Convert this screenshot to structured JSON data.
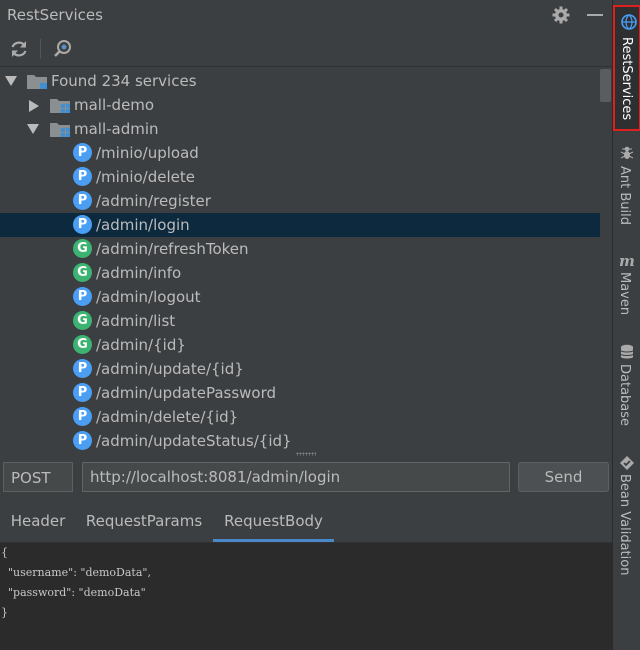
{
  "window": {
    "title": "RestServices"
  },
  "toolbar": {
    "refresh_icon": "refresh-icon",
    "search_icon": "search-service-icon"
  },
  "tree": {
    "root_label": "Found 234 services",
    "modules": [
      {
        "name": "mall-demo",
        "expanded": false
      },
      {
        "name": "mall-admin",
        "expanded": true
      }
    ],
    "services": [
      {
        "method_badge": "P",
        "path": "/minio/upload"
      },
      {
        "method_badge": "P",
        "path": "/minio/delete"
      },
      {
        "method_badge": "P",
        "path": "/admin/register"
      },
      {
        "method_badge": "P",
        "path": "/admin/login",
        "selected": true
      },
      {
        "method_badge": "G",
        "path": "/admin/refreshToken"
      },
      {
        "method_badge": "G",
        "path": "/admin/info"
      },
      {
        "method_badge": "P",
        "path": "/admin/logout"
      },
      {
        "method_badge": "G",
        "path": "/admin/list"
      },
      {
        "method_badge": "G",
        "path": "/admin/{id}"
      },
      {
        "method_badge": "P",
        "path": "/admin/update/{id}"
      },
      {
        "method_badge": "P",
        "path": "/admin/updatePassword"
      },
      {
        "method_badge": "P",
        "path": "/admin/delete/{id}"
      },
      {
        "method_badge": "P",
        "path": "/admin/updateStatus/{id}"
      }
    ]
  },
  "request": {
    "method": "POST",
    "url": "http://localhost:8081/admin/login",
    "send_label": "Send"
  },
  "tabs": [
    "Header",
    "RequestParams",
    "RequestBody"
  ],
  "active_tab": "RequestBody",
  "request_body": "{\n  \"username\": \"demoData\",\n  \"password\": \"demoData\"\n}",
  "side_tabs": [
    {
      "label": "RestServices",
      "active": true
    },
    {
      "label": "Ant Build"
    },
    {
      "label": "Maven"
    },
    {
      "label": "Database"
    },
    {
      "label": "Bean Validation"
    }
  ],
  "colors": {
    "background": "#3c3f41",
    "selected_row": "#0d293e",
    "post_badge": "#4a9ff5",
    "get_badge": "#3cb371",
    "active_tab_underline": "#4a88c7",
    "highlight_border": "#e02020"
  }
}
